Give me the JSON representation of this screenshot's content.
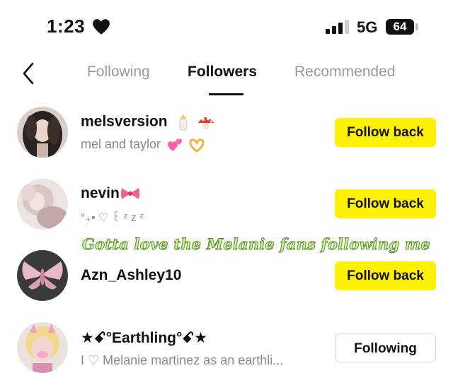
{
  "status_bar": {
    "time": "1:23",
    "network": "5G",
    "battery": "64"
  },
  "tabs": [
    {
      "label": "Following",
      "active": false
    },
    {
      "label": "Followers",
      "active": true
    },
    {
      "label": "Recommended",
      "active": false
    }
  ],
  "followers": [
    {
      "username": "melsversion",
      "bio": "mel and taylor",
      "button": "Follow back",
      "button_style": "yellow"
    },
    {
      "username": "nevin",
      "bio": "°₊• ♡ ꒰ ᶻ z ᶻ",
      "button": "Follow back",
      "button_style": "yellow"
    },
    {
      "username": "Azn_Ashley10",
      "bio": "",
      "button": "Follow back",
      "button_style": "yellow"
    },
    {
      "username": "★ꗃ°Earthling°ꗃ★",
      "bio": "I ♡ Melanie martinez as an earthli...",
      "button": "Following",
      "button_style": "outline"
    }
  ],
  "overlay_caption": "Gotta love the Melanie fans following me",
  "colors": {
    "follow_back_bg": "#fff200",
    "overlay_text": "#c9f59a"
  }
}
